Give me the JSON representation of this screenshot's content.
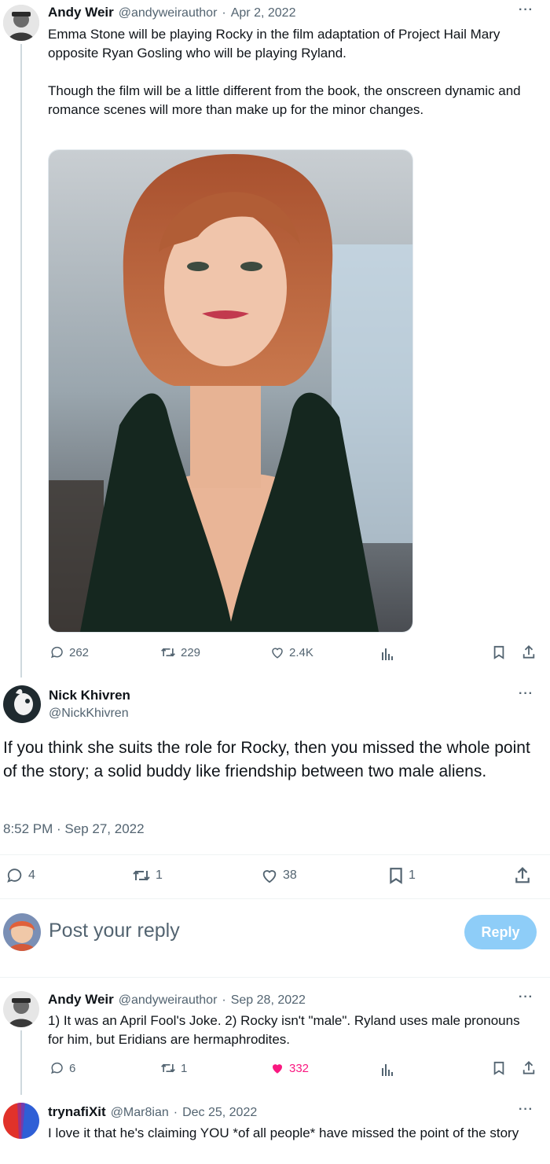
{
  "tweet1": {
    "name": "Andy Weir",
    "handle": "@andyweirauthor",
    "sep": "·",
    "date": "Apr 2, 2022",
    "more": "···",
    "text_p1": "Emma Stone will be playing Rocky in the film adaptation of Project Hail Mary opposite Ryan Gosling who will be playing Ryland.",
    "text_p2": "Though the film will be a little different from the book, the onscreen dynamic and romance scenes will more than make up for the minor changes.",
    "image_icon": "portrait-photo",
    "replies": "262",
    "retweets": "229",
    "likes": "2.4K"
  },
  "main_tweet": {
    "name": "Nick Khivren",
    "handle": "@NickKhivren",
    "more": "···",
    "text": "If you think she suits the role for Rocky, then you missed the whole point of the story; a solid buddy like friendship between two male aliens.",
    "timestamp": "8:52 PM · Sep 27, 2022",
    "replies": "4",
    "retweets": "1",
    "likes": "38",
    "bookmarks": "1"
  },
  "composer": {
    "placeholder": "Post your reply",
    "button_label": "Reply"
  },
  "reply1": {
    "name": "Andy Weir",
    "handle": "@andyweirauthor",
    "sep": "·",
    "date": "Sep 28, 2022",
    "more": "···",
    "text": "1) It was an April Fool's Joke. 2) Rocky isn't \"male\". Ryland uses male pronouns for him, but Eridians are hermaphrodites.",
    "replies": "6",
    "retweets": "1",
    "likes": "332"
  },
  "reply2": {
    "name": "trynafiXit",
    "handle": "@Mar8ian",
    "sep": "·",
    "date": "Dec 25, 2022",
    "more": "···",
    "text": "I love it that he's claiming YOU *of all people* have missed the point of the story"
  },
  "colors": {
    "like_active": "#f91880",
    "reply_button": "#8ecdf8",
    "muted": "#536471"
  }
}
